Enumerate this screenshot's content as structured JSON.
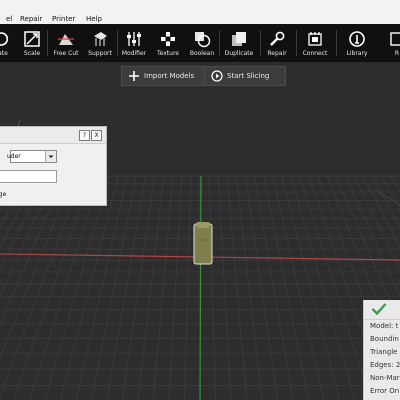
{
  "menu": [
    "el",
    "Repair",
    "Printer",
    "Help"
  ],
  "toolbar": [
    {
      "label": "ate",
      "icon": "rotate-icon"
    },
    {
      "label": "Scale",
      "icon": "scale-icon"
    },
    {
      "label": "Free Cut",
      "icon": "free-cut-icon"
    },
    {
      "label": "Support",
      "icon": "support-icon"
    },
    {
      "label": "Modifier",
      "icon": "modifier-icon"
    },
    {
      "label": "Texture",
      "icon": "texture-icon"
    },
    {
      "label": "Boolean",
      "icon": "boolean-icon"
    },
    {
      "label": "Duplicate",
      "icon": "duplicate-icon"
    },
    {
      "label": "Repair",
      "icon": "repair-icon"
    },
    {
      "label": "Connect",
      "icon": "connect-icon"
    },
    {
      "label": "Library",
      "icon": "library-icon"
    },
    {
      "label": "R",
      "icon": "r-icon"
    }
  ],
  "actions": {
    "import_label": "Import Models",
    "start_label": "Start Slicing"
  },
  "panel": {
    "help_label": "?",
    "close_label": "X",
    "select_value": "uder",
    "text_value": "",
    "option_label": "nge"
  },
  "info": {
    "status_icon": "check-icon",
    "rows": [
      "Model: t",
      "Boundin",
      "Triangle",
      "Edges: 2",
      "Non-Mar",
      "Error On"
    ]
  },
  "colors": {
    "viewport_bg": "#2d2d2d",
    "grid": "#3a3a3a",
    "axis_red": "#b14646",
    "axis_green": "#3d8f3d",
    "check_green": "#3f9a55",
    "model": "#8b8a57"
  }
}
